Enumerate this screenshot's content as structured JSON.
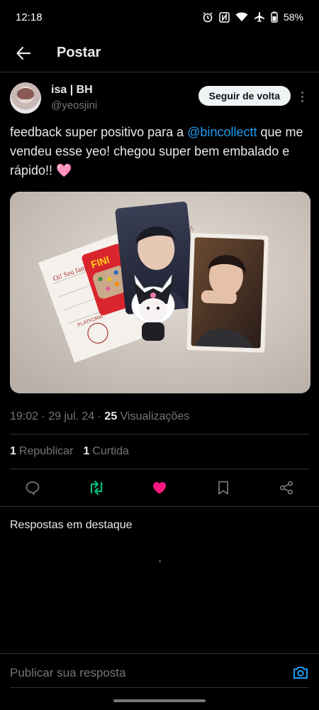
{
  "status_bar": {
    "time": "12:18",
    "battery": "58%",
    "icons": [
      "alarm-icon",
      "nfc-icon",
      "wifi-icon",
      "airplane-icon",
      "battery-icon"
    ]
  },
  "nav": {
    "title": "Postar",
    "back_icon": "arrow-left-icon"
  },
  "author": {
    "name": "isa | BH",
    "handle": "@yeosjini",
    "follow_label": "Seguir de volta"
  },
  "tweet": {
    "text_before": "feedback super positivo para a ",
    "mention": "@bincollectt",
    "text_after": " que me vendeu esse yeo! chegou super bem embalado e rápido!! ",
    "emoji": "🩷"
  },
  "media": {
    "note_text": "Oi! Seu fanpage... Obrigada pela compra, divirta-se!",
    "note_brand": "PLATFORM",
    "candy_label": "FINI"
  },
  "meta": {
    "time": "19:02",
    "date": "29 jul. 24",
    "views_count": "25",
    "views_label": "Visualizações"
  },
  "stats": {
    "reposts_count": "1",
    "reposts_label": "Republicar",
    "likes_count": "1",
    "likes_label": "Curtida"
  },
  "actions": [
    "reply-icon",
    "repost-icon",
    "like-icon",
    "bookmark-icon",
    "share-icon"
  ],
  "colors": {
    "accent": "#1d9bf0",
    "repost_active": "#00ba7c",
    "like_active": "#f91880"
  },
  "replies": {
    "heading": "Respostas em destaque"
  },
  "reply_bar": {
    "placeholder": "Publicar sua resposta"
  }
}
